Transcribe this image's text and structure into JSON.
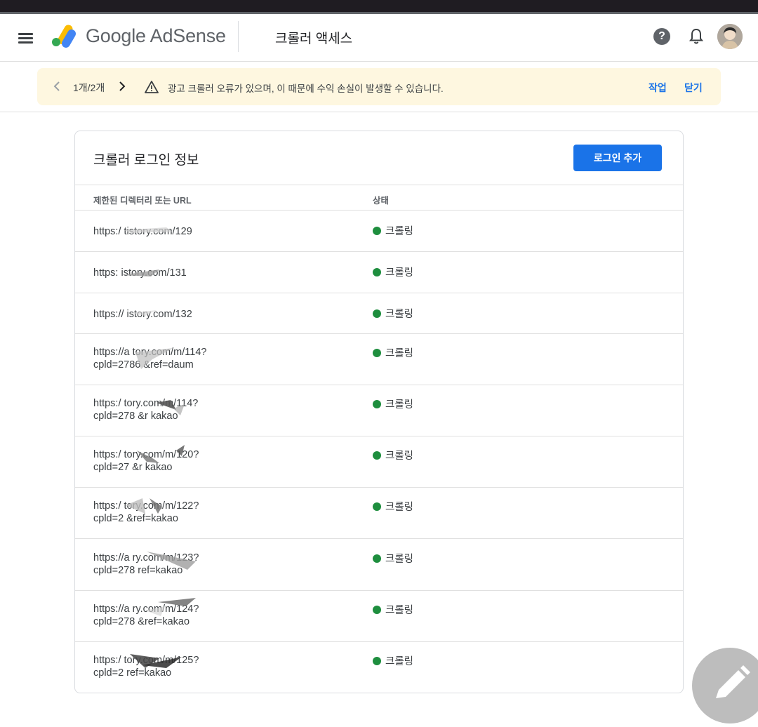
{
  "app": {
    "brand": "Google AdSense",
    "page_title": "크롤러 액세스",
    "icons": [
      "menu-icon",
      "adsense-logo-icon",
      "help-icon",
      "bell-icon",
      "avatar"
    ],
    "colors": {
      "accent": "#1a73e8",
      "status_ok": "#1e8e3e",
      "banner_bg": "#fef7e0"
    }
  },
  "banner": {
    "pager": "1개/2개",
    "message": "광고 크롤러 오류가 있으며, 이 때문에 수익 손실이 발생할 수 있습니다.",
    "action_label": "작업",
    "close_label": "닫기"
  },
  "card": {
    "title": "크롤러 로그인 정보",
    "add_button": "로그인 추가",
    "columns": {
      "url": "제한된 디렉터리 또는 URL",
      "status": "상태"
    },
    "rows": [
      {
        "url": "https:/        tistory.com/129",
        "status": "크롤링"
      },
      {
        "url": "https:         istory.com/131",
        "status": "크롤링"
      },
      {
        "url": "https://       istory.com/132",
        "status": "크롤링"
      },
      {
        "url": "https://a          tory.com/m/114?\ncpld=2786   &ref=daum",
        "status": "크롤링"
      },
      {
        "url": "https:/         tory.com/m/114?\ncpld=278    &r   kakao",
        "status": "크롤링"
      },
      {
        "url": "https:/         tory.com/m/120?\ncpld=27     &r   kakao",
        "status": "크롤링"
      },
      {
        "url": "https:/         tory.com/m/122?\ncpld=2      &ref=kakao",
        "status": "크롤링"
      },
      {
        "url": "https://a          ry.com/m/123?\ncpld=278     ref=kakao",
        "status": "크롤링"
      },
      {
        "url": "https://a          ry.com/m/124?\ncpld=278    &ref=kakao",
        "status": "크롤링"
      },
      {
        "url": "https:/         tory.com/m/125?\ncpld=2      ref=kakao",
        "status": "크롤링"
      }
    ]
  },
  "fab": {
    "icon": "edit-pencil-icon"
  }
}
